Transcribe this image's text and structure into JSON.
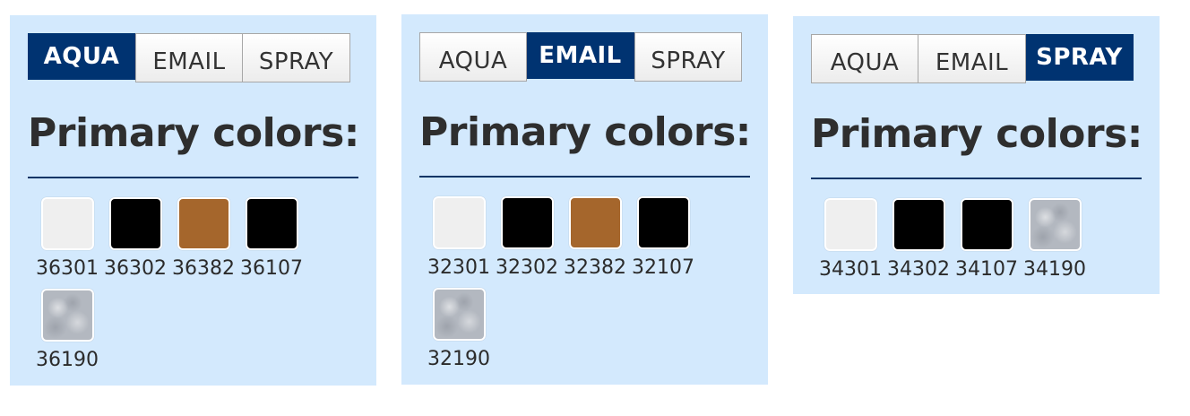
{
  "tab_labels": [
    "AQUA",
    "EMAIL",
    "SPRAY"
  ],
  "colors": {
    "active_tab": "#003371",
    "panel_background": "#d3e9fd",
    "heading_rule": "#0b3566"
  },
  "panels": [
    {
      "active_tab": "AQUA",
      "heading": "Primary colors:",
      "swatches": [
        {
          "code": "36301",
          "color": "#efefef"
        },
        {
          "code": "36302",
          "color": "#000000"
        },
        {
          "code": "36382",
          "color": "#a5662c"
        },
        {
          "code": "36107",
          "color": "#000000"
        },
        {
          "code": "36190",
          "color": "silver"
        }
      ]
    },
    {
      "active_tab": "EMAIL",
      "heading": "Primary colors:",
      "swatches": [
        {
          "code": "32301",
          "color": "#efefef"
        },
        {
          "code": "32302",
          "color": "#000000"
        },
        {
          "code": "32382",
          "color": "#a5662c"
        },
        {
          "code": "32107",
          "color": "#000000"
        },
        {
          "code": "32190",
          "color": "silver"
        }
      ]
    },
    {
      "active_tab": "SPRAY",
      "heading": "Primary colors:",
      "swatches": [
        {
          "code": "34301",
          "color": "#efefef"
        },
        {
          "code": "34302",
          "color": "#000000"
        },
        {
          "code": "34107",
          "color": "#000000"
        },
        {
          "code": "34190",
          "color": "silver"
        }
      ]
    }
  ]
}
